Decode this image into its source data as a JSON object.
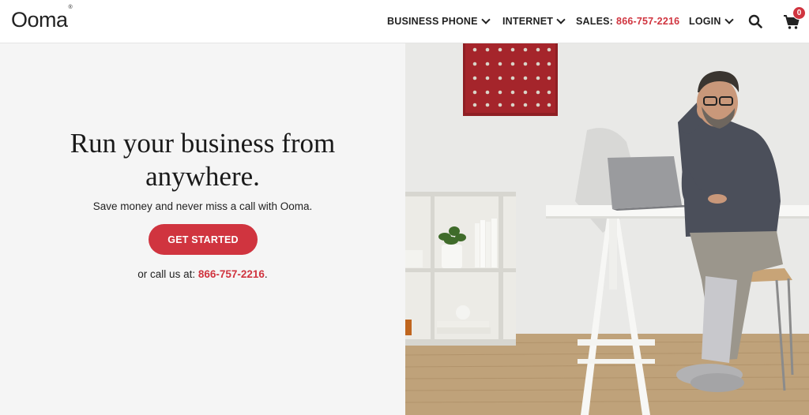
{
  "header": {
    "logo": "Ooma",
    "logo_mark": "®",
    "nav": {
      "business_phone": "BUSINESS PHONE",
      "internet": "INTERNET",
      "sales_label": "SALES:",
      "sales_phone": "866-757-2216",
      "login": "LOGIN"
    },
    "icons": {
      "search": "search-icon",
      "cart": "cart-icon",
      "chevron": "chevron-down-icon"
    },
    "cart_count": "0"
  },
  "hero": {
    "title_line1": "Run your business from",
    "title_line2": "anywhere.",
    "subtitle": "Save money and never miss a call with Ooma.",
    "cta_label": "GET STARTED",
    "call_prefix": "or call us at:",
    "call_phone": "866-757-2216",
    "call_suffix": "."
  },
  "colors": {
    "accent": "#d0343f",
    "hero_bg": "#f5f5f5",
    "text": "#222222"
  }
}
